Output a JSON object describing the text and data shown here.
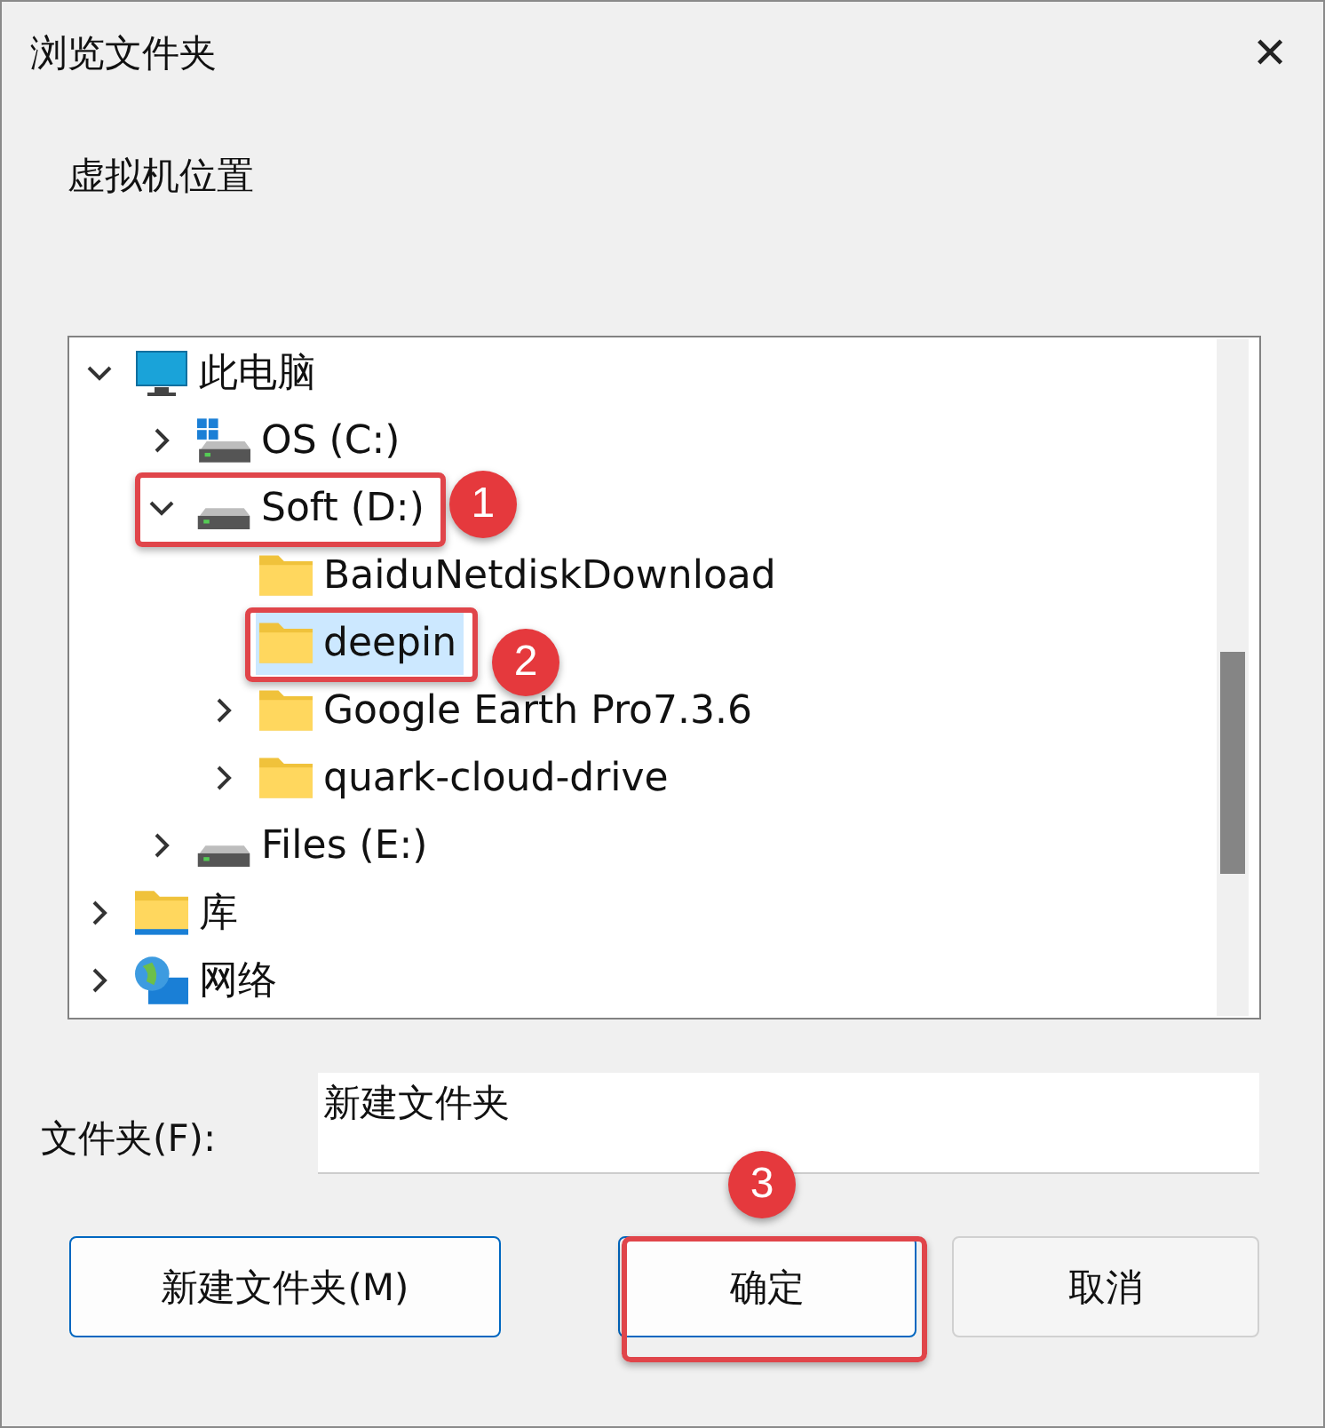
{
  "window": {
    "title": "浏览文件夹",
    "close": "✕"
  },
  "description": "虚拟机位置",
  "tree": [
    {
      "label": "此电脑",
      "kind": "pc",
      "expanded": true,
      "selected": false,
      "children": [
        {
          "label": "OS (C:)",
          "kind": "drive_win",
          "expanded": false,
          "selected": false
        },
        {
          "label": "Soft (D:)",
          "kind": "drive",
          "expanded": true,
          "selected": false,
          "callout": "1",
          "children": [
            {
              "label": "BaiduNetdiskDownload",
              "kind": "folder",
              "selected": false
            },
            {
              "label": "deepin",
              "kind": "folder",
              "selected": true,
              "callout": "2"
            },
            {
              "label": "Google Earth Pro7.3.6",
              "kind": "folder",
              "expanded": false,
              "selected": false
            },
            {
              "label": "quark-cloud-drive",
              "kind": "folder",
              "expanded": false,
              "selected": false
            }
          ]
        },
        {
          "label": "Files (E:)",
          "kind": "drive",
          "expanded": false,
          "selected": false
        }
      ]
    },
    {
      "label": "库",
      "kind": "library",
      "expanded": false,
      "selected": false
    },
    {
      "label": "网络",
      "kind": "network",
      "expanded": false,
      "selected": false
    }
  ],
  "folder_field": {
    "label": "文件夹(F):",
    "value": "新建文件夹"
  },
  "buttons": [
    {
      "label": "新建文件夹(M)",
      "kind": "new"
    },
    {
      "label": "确定",
      "kind": "ok",
      "callout": "3"
    },
    {
      "label": "取消",
      "kind": "cancel"
    }
  ]
}
